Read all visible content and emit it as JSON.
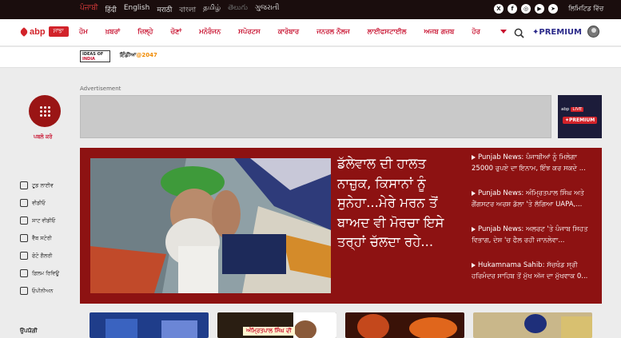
{
  "languages": [
    {
      "label": "ਪੰਜਾਬੀ",
      "active": true
    },
    {
      "label": "हिंदी"
    },
    {
      "label": "English"
    },
    {
      "label": "मराठी"
    },
    {
      "label": "বাংলা"
    },
    {
      "label": "தமிழ்"
    },
    {
      "label": "తెలుగు",
      "dim": true
    },
    {
      "label": "ગુજરાતી"
    }
  ],
  "social_icons": [
    "x-icon",
    "facebook-icon",
    "instagram-icon",
    "youtube-icon",
    "telegram-icon",
    "whatsapp-icon"
  ],
  "login_label": "ਲਿਮਿਟਿਡ ਵਿੱਚ",
  "logo": {
    "brand": "abp",
    "sub": "ਸਾਂਝਾ"
  },
  "nav": [
    "ਹੋਮ",
    "ਖ਼ਬਰਾਂ",
    "ਜ਼ਿਲ੍ਹੇ",
    "ਚੋਣਾਂ",
    "ਮਨੋਰੰਜਨ",
    "ਸਪੋਰਟਸ",
    "ਕਾਰੋਬਾਰ",
    "ਜਨਰਲ ਨੌਲਜ",
    "ਲਾਈਫਸਟਾਈਲ",
    "ਅਜਬ ਗਜ਼ਬ",
    "ਹੋਰ"
  ],
  "premium_label": "✦PREMIUM",
  "substrip": {
    "ideas_line1": "IDEAS OF",
    "ideas_line2": "INDIA",
    "india2047_prefix": "ਇੰਡੀਆ",
    "india2047_suffix": "@2047"
  },
  "apps_label": "ਪਬਲੋ ਕਰੋ",
  "sidebar": [
    {
      "label": "ਟੂਡ ਲਾਈਵ",
      "icon": "tv-icon"
    },
    {
      "label": "ਵੀਡੀਓ",
      "icon": "play-icon"
    },
    {
      "label": "ਸ਼ਾਟ ਵੀਡੀਓ",
      "icon": "short-video-icon"
    },
    {
      "label": "ਵੈੱਬ ਸਟੋਰੀ",
      "icon": "web-story-icon"
    },
    {
      "label": "ਫੋਟੋ ਗੈਲਰੀ",
      "icon": "photo-icon"
    },
    {
      "label": "ਫ਼ਿਲਮ ਰਿਵਿਊ",
      "icon": "film-icon"
    },
    {
      "label": "ਓਪੀਨੀਅਨ",
      "icon": "opinion-icon"
    }
  ],
  "sidebar_bottom": "ਉਪਯੋਗੀ",
  "ad_label": "Advertisement",
  "live_card": {
    "brand": "abp",
    "live": "LIVE",
    "premium": "✦PREMIUM"
  },
  "hero": {
    "headline": "ਡੱਲੇਵਾਲ ਦੀ ਹਾਲਤ ਨਾਜ਼ੁਕ, ਕਿਸਾਨਾਂ ਨੂੰ ਸੁਨੇਹਾ...ਮੇਰੇ ਮਰਨ ਤੋਂ ਬਾਅਦ ਵੀ ਮੋਰਚਾ ਇਸੇ ਤਰ੍ਹਾਂ ਚੱਲਦਾ ਰਹੇ...",
    "side_news": [
      "Punjab News: ਪੰਜਾਬੀਆਂ ਨੂੰ ਮਿਲੇਗਾ 25000 ਰੁਪਏ ਦਾ ਇਨਾਮ, ਇੰਝ ਕਰ ਸਕਦੇ ...",
      "Punjab News: ਅੰਮ੍ਰਿਤਪਾਲ ਸਿੰਘ ਅਤੇ ਗੈਂਗਸਟਰ ਅਰਸ਼ ਡੱਲਾ 'ਤੇ ਲੱਗਿਆ UAPA,...",
      "Punjab News: ਅਲਰਟ 'ਤੇ ਪੰਜਾਬ ਸਿਹਤ ਵਿਭਾਗ, ਦੇਸ਼ 'ਚ ਫੈਲ ਰਹੀ ਜਾਨਲੇਵਾ...",
      "Hukamnama Sahib: ਸੱਚਖੰਡ ਸ੍ਰੀ ਹਰਿਮੰਦਰ ਸਾਹਿਬ ਤੋਂ ਮੁੱਖ ਅੱਜ ਦਾ ਮੁੱਖਵਾਕ 0..."
    ]
  },
  "cards": [
    {
      "tag": ""
    },
    {
      "tag": "ਅੰਮ੍ਰਿਤਪਾਲ ਸਿੰਘ ਦੀ"
    },
    {
      "tag": ""
    },
    {
      "tag": ""
    }
  ],
  "colors": {
    "brand_red": "#c8102e",
    "hero_bg": "#8d1212",
    "topbar_bg": "#1a0d0d",
    "premium": "#2b2a8a"
  }
}
